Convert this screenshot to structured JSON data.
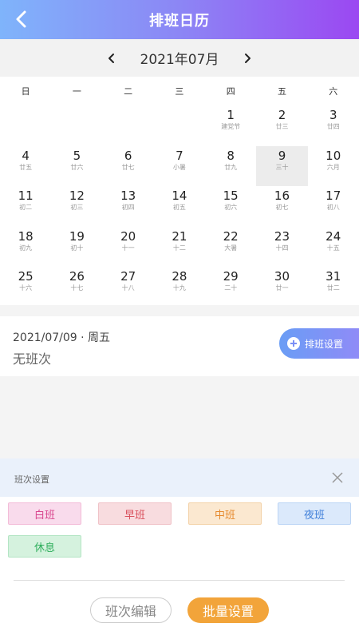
{
  "header": {
    "title": "排班日历",
    "back_icon": "chevron-left-icon"
  },
  "month_nav": {
    "label": "2021年07月",
    "prev_icon": "chevron-left-icon",
    "next_icon": "chevron-right-icon"
  },
  "weekdays": [
    "日",
    "一",
    "二",
    "三",
    "四",
    "五",
    "六"
  ],
  "weeks": [
    [
      {
        "n": "",
        "s": ""
      },
      {
        "n": "",
        "s": ""
      },
      {
        "n": "",
        "s": ""
      },
      {
        "n": "",
        "s": ""
      },
      {
        "n": "1",
        "s": "建党节"
      },
      {
        "n": "2",
        "s": "廿三"
      },
      {
        "n": "3",
        "s": "廿四"
      }
    ],
    [
      {
        "n": "4",
        "s": "廿五"
      },
      {
        "n": "5",
        "s": "廿六"
      },
      {
        "n": "6",
        "s": "廿七"
      },
      {
        "n": "7",
        "s": "小暑"
      },
      {
        "n": "8",
        "s": "廿九"
      },
      {
        "n": "9",
        "s": "三十",
        "selected": true
      },
      {
        "n": "10",
        "s": "六月"
      }
    ],
    [
      {
        "n": "11",
        "s": "初二"
      },
      {
        "n": "12",
        "s": "初三"
      },
      {
        "n": "13",
        "s": "初四"
      },
      {
        "n": "14",
        "s": "初五"
      },
      {
        "n": "15",
        "s": "初六"
      },
      {
        "n": "16",
        "s": "初七"
      },
      {
        "n": "17",
        "s": "初八"
      }
    ],
    [
      {
        "n": "18",
        "s": "初九"
      },
      {
        "n": "19",
        "s": "初十"
      },
      {
        "n": "20",
        "s": "十一"
      },
      {
        "n": "21",
        "s": "十二"
      },
      {
        "n": "22",
        "s": "大暑"
      },
      {
        "n": "23",
        "s": "十四"
      },
      {
        "n": "24",
        "s": "十五"
      }
    ],
    [
      {
        "n": "25",
        "s": "十六"
      },
      {
        "n": "26",
        "s": "十七"
      },
      {
        "n": "27",
        "s": "十八"
      },
      {
        "n": "28",
        "s": "十九"
      },
      {
        "n": "29",
        "s": "二十"
      },
      {
        "n": "30",
        "s": "廿一"
      },
      {
        "n": "31",
        "s": "廿二"
      }
    ]
  ],
  "selected_info": {
    "date": "2021/07/09 · 周五",
    "status": "无班次"
  },
  "shift_setting_button": {
    "label": "排班设置",
    "icon": "plus-circle-icon"
  },
  "shift_panel": {
    "title": "班次设置",
    "close_icon": "close-icon",
    "shifts": [
      {
        "label": "白班",
        "bg": "#f9dbec",
        "color": "#d9468e",
        "border": "#f3bcd8"
      },
      {
        "label": "早班",
        "bg": "#f8dcdf",
        "color": "#d9505c",
        "border": "#f0c2c7"
      },
      {
        "label": "中班",
        "bg": "#fbe8d0",
        "color": "#e68a2e",
        "border": "#f3d2a8"
      },
      {
        "label": "夜班",
        "bg": "#dbe9fb",
        "color": "#3f7fd9",
        "border": "#bcd5f5"
      },
      {
        "label": "休息",
        "bg": "#d5f2de",
        "color": "#2eae5c",
        "border": "#b4e5c4"
      }
    ],
    "edit_button": "班次编辑",
    "batch_button": "批量设置"
  },
  "colors": {
    "header_gradient": [
      "#7fb4fb",
      "#9b48f2"
    ],
    "accent_orange": "#f2a43a",
    "selected_day_bg": "#ececec"
  }
}
